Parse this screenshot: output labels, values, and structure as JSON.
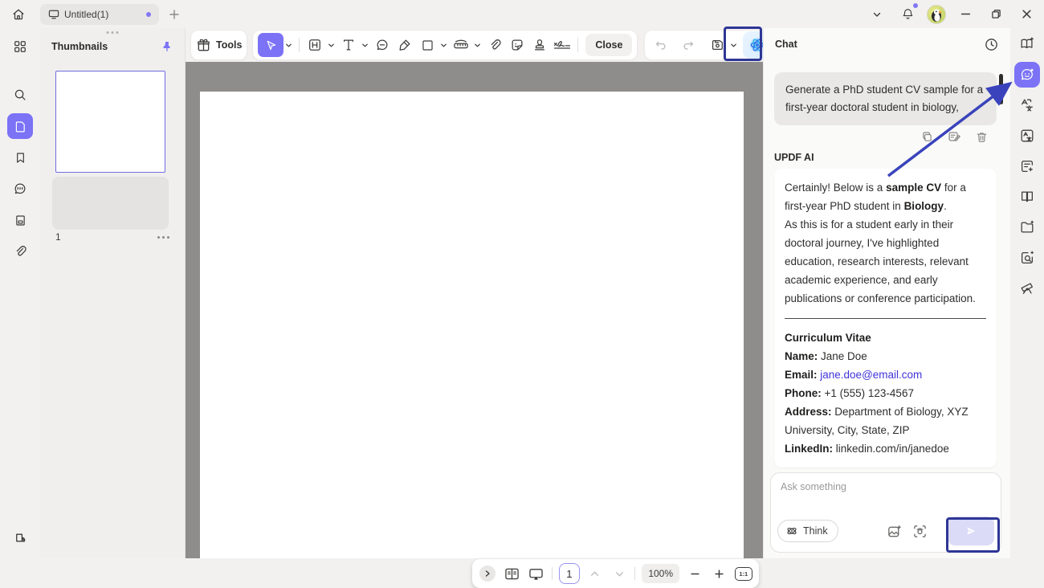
{
  "titlebar": {
    "tab_title": "Untitled(1)"
  },
  "thumbnails": {
    "title": "Thumbnails",
    "page_label": "1"
  },
  "toolbar": {
    "tools_label": "Tools",
    "close_label": "Close",
    "icons": [
      "tools-gift",
      "select-cursor",
      "edit-h",
      "text-t",
      "comment",
      "highlighter",
      "shape-square",
      "measure-ruler",
      "attachment",
      "sticker",
      "stamp",
      "signature",
      "undo",
      "redo",
      "save",
      "updf-ai"
    ]
  },
  "chat": {
    "title": "Chat",
    "user_message": "Generate a PhD student CV sample for a first-year doctoral student in biology,",
    "ai_name": "UPDF AI",
    "ai_message": {
      "paragraphs": [
        {
          "segments": [
            {
              "t": "Certainly! Below is a "
            },
            {
              "t": "sample CV",
              "b": true
            },
            {
              "t": " for a first-year PhD student in "
            },
            {
              "t": "Biology",
              "b": true
            },
            {
              "t": "."
            }
          ]
        },
        {
          "segments": [
            {
              "t": "As this is for a student early in their doctoral journey, I've highlighted education, research interests, relevant academic experience, and early publications or conference participation."
            }
          ]
        }
      ],
      "cv_heading": "Curriculum Vitae",
      "cv_fields": [
        {
          "label": "Name:",
          "value": "Jane Doe",
          "link": false
        },
        {
          "label": "Email:",
          "value": "jane.doe@email.com",
          "link": true
        },
        {
          "label": "Phone:",
          "value": "+1 (555) 123-4567",
          "link": false
        },
        {
          "label": "Address:",
          "value": "Department of Biology, XYZ University, City, State, ZIP",
          "link": false
        },
        {
          "label": "LinkedIn:",
          "value": "linkedin.com/in/janedoe",
          "link": false
        }
      ]
    },
    "input_placeholder": "Ask something",
    "think_label": "Think",
    "message_action_icons": [
      "copy",
      "edit",
      "delete"
    ]
  },
  "statusbar": {
    "page": "1",
    "zoom": "100%",
    "actual_size_label": "1:1"
  },
  "colors": {
    "accent_purple": "#7b72f6",
    "annotation_navy": "#2e3695",
    "arrow_blue": "#3a43bb",
    "link_blue": "#4133d8",
    "canvas_gray": "#8e8d8c"
  }
}
